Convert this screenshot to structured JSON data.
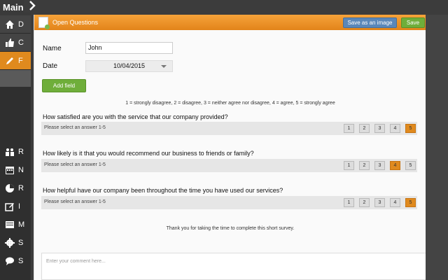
{
  "app": {
    "sidebar_title": "Main"
  },
  "sidebar": {
    "items": [
      {
        "letter": "D",
        "icon": "home-icon"
      },
      {
        "letter": "C",
        "icon": "thumbs-up-icon"
      },
      {
        "letter": "F",
        "icon": "pencil-icon",
        "active": true
      }
    ],
    "lower_items": [
      {
        "letter": "R",
        "icon": "people-icon"
      },
      {
        "letter": "N",
        "icon": "calendar-icon"
      },
      {
        "letter": "R",
        "icon": "pie-chart-icon"
      },
      {
        "letter": "I",
        "icon": "edit-icon"
      },
      {
        "letter": "M",
        "icon": "inbox-icon"
      },
      {
        "letter": "S",
        "icon": "gear-icon"
      },
      {
        "letter": "S",
        "icon": "chat-icon"
      }
    ]
  },
  "modal": {
    "title": "Open Questions",
    "save_image_label": "Save as an image",
    "save_label": "Save"
  },
  "form": {
    "name_label": "Name",
    "name_value": "John",
    "date_label": "Date",
    "date_value": "10/04/2015",
    "add_field_label": "Add field"
  },
  "scale_text": "1 = strongly disagree,  2 = disagree,  3 = neither agree nor disagree, 4 = agree, 5 = strongly agree",
  "questions": [
    {
      "text": "How satisfied are you with the service that our company provided?",
      "hint": "Please select an answer 1-5",
      "selected": 5
    },
    {
      "text": "How likely is it that you would recommend our business to friends or family?",
      "hint": "Please select an answer 1-5",
      "selected": 4
    },
    {
      "text": "How helpful have our company been throughout the time you have used our services?",
      "hint": "Please select an answer 1-5",
      "selected": 5
    }
  ],
  "ratings": [
    "1",
    "2",
    "3",
    "4",
    "5"
  ],
  "thanks_text": "Thank you for taking the time to complete this short survey.",
  "comment_placeholder": "Enter your comment here...",
  "colors": {
    "accent": "#e08a1e",
    "green": "#6fae3a",
    "blue": "#5a87b9"
  }
}
